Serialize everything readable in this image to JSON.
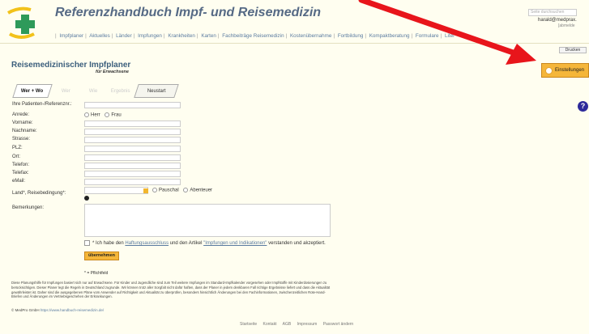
{
  "site": {
    "title": "Referenzhandbuch Impf- und Reisemedizin"
  },
  "nav": {
    "items": [
      "Impfplaner",
      "Aktuelles",
      "Länder",
      "Impfungen",
      "Krankheiten",
      "Karten",
      "Fachbeiträge Reisemedizin",
      "Kostenübernahme",
      "Fortbildung",
      "Kompaktberatung",
      "Formulare",
      "Liter"
    ]
  },
  "header": {
    "search_placeholder": "Seite durchsuchen",
    "user_email": "harald@medprax.",
    "user_action": "[abmelde"
  },
  "toolbar": {
    "print_label": "Drucken",
    "settings_label": "Einstellungen"
  },
  "page": {
    "title": "Reisemedizinischer Impfplaner",
    "subtitle": "für Erwachsene"
  },
  "wizard": {
    "steps": [
      "Wer + Wo",
      "Wer",
      "Wie",
      "Ergebnis"
    ],
    "reset_label": "Neustart"
  },
  "form": {
    "patient_id_label": "Ihre Patienten-/Referenznr.:",
    "salutation_label": "Anrede:",
    "salutation_options": [
      "Herr",
      "Frau"
    ],
    "firstname_label": "Vorname:",
    "lastname_label": "Nachname:",
    "street_label": "Strasse:",
    "zip_label": "PLZ:",
    "city_label": "Ort:",
    "phone_label": "Telefon:",
    "fax_label": "Telefax:",
    "email_label": "eMail:",
    "country_label": "Land*, Reisebedingung*:",
    "trip_options": [
      "Pauschal",
      "Abenteuer"
    ],
    "remarks_label": "Bemerkungen:",
    "agree_prefix": "* Ich habe den ",
    "agree_link1": "Haftungsausschluss",
    "agree_mid": " und den Artikel ",
    "agree_link2": "\"Impfungen und Indikationen\"",
    "agree_suffix": " verstanden und akzeptiert.",
    "submit_label": "übernehmen",
    "mandatory_note": "* = Pflichtfeld"
  },
  "disclaimer": "Diese Planungshilfe für Impfungen basiert sich nur auf Erwachsene. Für Kinder und Jugendliche sind zum Teil weitere Impfungen im Standard-Impfkalender vorgesehen oder Impfstoffe mit Kinderdosierungen zu berücksichtigen. Dieser Planer legt die Regeln in Deutschland zugrunde. Wir können trotz aller Sorgfalt nicht dafür haften, dass der Planer in jedem denkbaren Fall richtige Ergebnisse liefert und dass die Aktualität gewährleistet ist. Daher sind die ausgegebenen Pläne vom Anwender auf Richtigkeit und Aktualität zu überprüfen, besonders hinsichtlich Änderungen bei den Fachinformationen, zwischenzeitlichen Rote-Hand-Briefen und Änderungen im Vertriebsgeschehen der Erkrankungen.",
  "copyright": {
    "prefix": "© MedPro GmbH ",
    "link": "https://www.handbuch-reisemedizin.de/"
  },
  "footer": {
    "links": [
      "Startseite",
      "Kontakt",
      "AGB",
      "Impressum",
      "Passwort ändern"
    ]
  },
  "colors": {
    "accent": "#f5b63a",
    "link": "#5a7ba0",
    "title": "#3c5f7d",
    "arrow": "#e8151b"
  }
}
